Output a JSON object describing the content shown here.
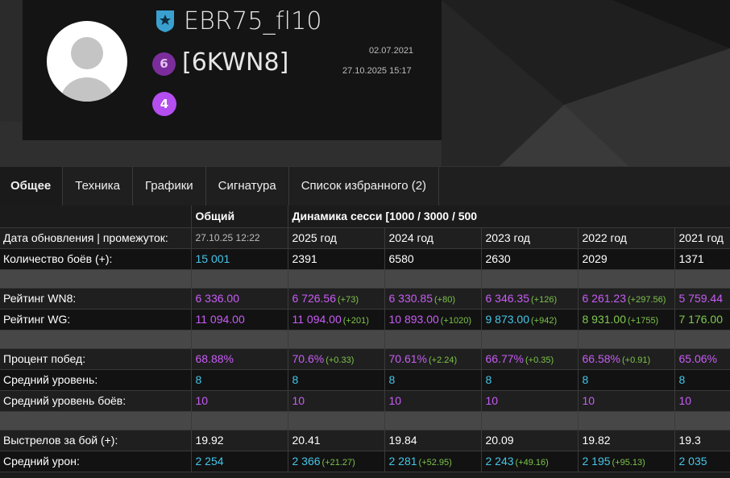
{
  "header": {
    "player_name": "EBR75_fl10",
    "clan_tag": "[6KWN8]",
    "clan_badge_number": "6",
    "tier_badge_number": "4",
    "date_created": "02.07.2021",
    "date_last_battle": "27.10.2025 15:17"
  },
  "tabs": [
    {
      "label": "Общее",
      "active": true
    },
    {
      "label": "Техника"
    },
    {
      "label": "Графики"
    },
    {
      "label": "Сигнатура"
    },
    {
      "label": "Список избранного (2)"
    }
  ],
  "table": {
    "col_header_overall": "Общий",
    "col_header_dynamics": "Динамика сесси",
    "col_header_dynamics_range": "[1000 / 3000 / 500",
    "update_label": "Дата обновления | промежуток:",
    "update_value": "27.10.25 12:22",
    "years": [
      "2025 год",
      "2024 год",
      "2023 год",
      "2022 год",
      "2021 год"
    ],
    "battles": {
      "label": "Количество боёв (+):",
      "overall": "15 001",
      "values": [
        "2391",
        "6580",
        "2630",
        "2029",
        "1371"
      ]
    },
    "wn8": {
      "label": "Рейтинг WN8:",
      "overall": "6 336.00",
      "values": [
        "6 726.56",
        "6 330.85",
        "6 346.35",
        "6 261.23",
        "5 759.44"
      ],
      "deltas": [
        "(+73)",
        "(+80)",
        "(+126)",
        "(+297.56)",
        ""
      ]
    },
    "wg": {
      "label": "Рейтинг WG:",
      "overall": "11 094.00",
      "values": [
        "11 094.00",
        "10 893.00",
        "9 873.00",
        "8 931.00",
        "7 176.00"
      ],
      "deltas": [
        "(+201)",
        "(+1020)",
        "(+942)",
        "(+1755)",
        ""
      ]
    },
    "winrate": {
      "label": "Процент побед:",
      "overall": "68.88%",
      "values": [
        "70.6%",
        "70.61%",
        "66.77%",
        "66.58%",
        "65.06%"
      ],
      "deltas": [
        "(+0.33)",
        "(+2.24)",
        "(+0.35)",
        "(+0.91)",
        ""
      ]
    },
    "avg_tier": {
      "label": "Средний уровень:",
      "overall": "8",
      "values": [
        "8",
        "8",
        "8",
        "8",
        "8"
      ]
    },
    "avg_battle_tier": {
      "label": "Средний уровень боёв:",
      "overall": "10",
      "values": [
        "10",
        "10",
        "10",
        "10",
        "10"
      ]
    },
    "shots": {
      "label": "Выстрелов за бой (+):",
      "overall": "19.92",
      "values": [
        "20.41",
        "19.84",
        "20.09",
        "19.82",
        "19.3"
      ]
    },
    "damage": {
      "label": "Средний урон:",
      "overall": "2 254",
      "values": [
        "2 366",
        "2 281",
        "2 243",
        "2 195",
        "2 035"
      ],
      "deltas": [
        "(+21.27)",
        "(+52.95)",
        "(+49.16)",
        "(+95.13)",
        ""
      ]
    }
  },
  "colors": {
    "cyan": "#45c6e8",
    "purple": "#c85cf5",
    "green": "#80c850",
    "delta_green": "#7cc44a"
  }
}
